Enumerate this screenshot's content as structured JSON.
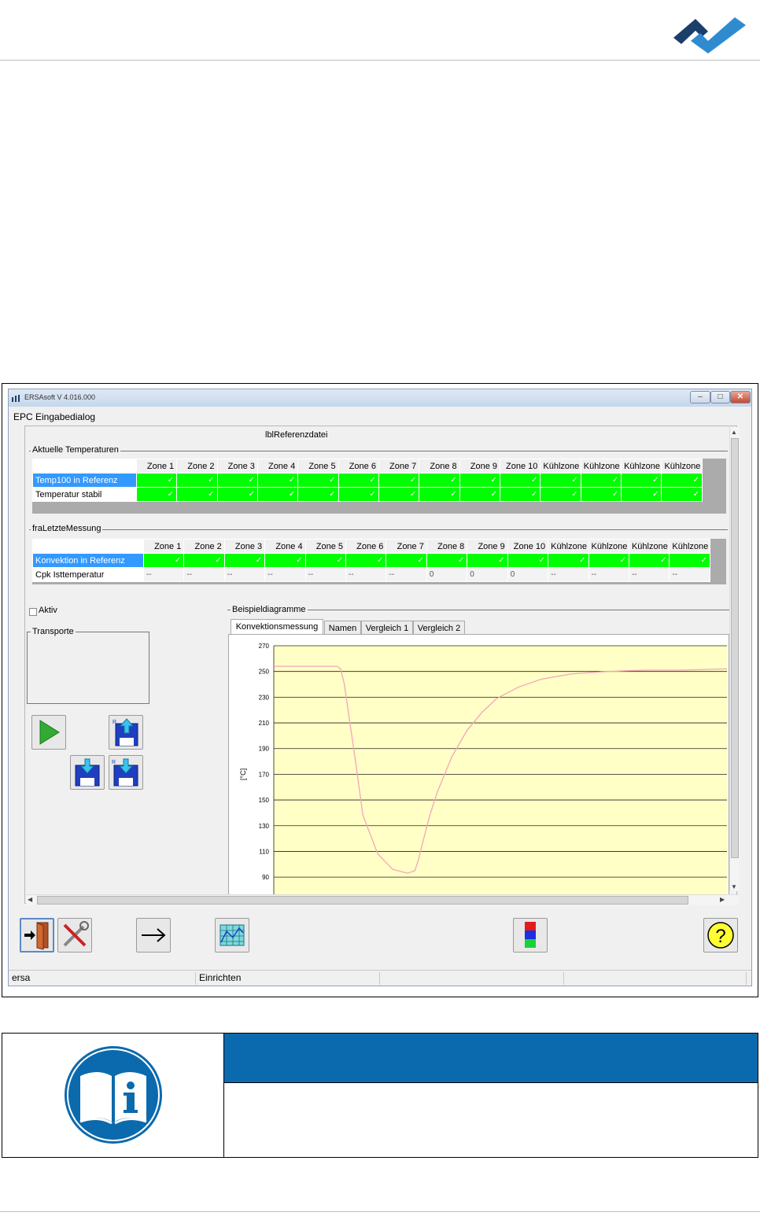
{
  "window": {
    "title": "ERSAsoft V 4.016.000",
    "dialog_caption": "EPC Eingabedialog",
    "reference_label": "lblReferenzdatei",
    "close_glyph": "✕",
    "minimize_glyph": "–",
    "maximize_glyph": "□"
  },
  "current_temps": {
    "group_title": "Aktuelle Temperaturen",
    "columns": [
      "Zone 1",
      "Zone 2",
      "Zone 3",
      "Zone 4",
      "Zone 5",
      "Zone 6",
      "Zone 7",
      "Zone 8",
      "Zone 9",
      "Zone 10",
      "Kühlzone 1",
      "Kühlzone 2",
      "Kühlzone 3",
      "Kühlzone 4"
    ],
    "rows": [
      {
        "label": "Temp100 in Referenz",
        "selected": true,
        "cells": [
          "✓",
          "✓",
          "✓",
          "✓",
          "✓",
          "✓",
          "✓",
          "✓",
          "✓",
          "✓",
          "✓",
          "✓",
          "✓",
          "✓"
        ]
      },
      {
        "label": "Temperatur stabil",
        "selected": false,
        "cells": [
          "✓",
          "✓",
          "✓",
          "✓",
          "✓",
          "✓",
          "✓",
          "✓",
          "✓",
          "✓",
          "✓",
          "✓",
          "✓",
          "✓"
        ]
      }
    ]
  },
  "last_measurement": {
    "group_title": "fraLetzteMessung",
    "columns": [
      "Zone 1",
      "Zone 2",
      "Zone 3",
      "Zone 4",
      "Zone 5",
      "Zone 6",
      "Zone 7",
      "Zone 8",
      "Zone 9",
      "Zone 10",
      "Kühlzone 1",
      "Kühlzone 2",
      "Kühlzone 3",
      "Kühlzone 4"
    ],
    "rows": [
      {
        "label": "Konvektion in Referenz",
        "selected": true,
        "cells": [
          "✓",
          "✓",
          "✓",
          "✓",
          "✓",
          "✓",
          "✓",
          "✓",
          "✓",
          "✓",
          "✓",
          "✓",
          "✓",
          "✓"
        ]
      },
      {
        "label": "Cpk Isttemperatur",
        "selected": false,
        "cells": [
          "--",
          "--",
          "--",
          "--",
          "--",
          "--",
          "--",
          "0",
          "0",
          "0",
          "--",
          "--",
          "--",
          "--"
        ]
      }
    ]
  },
  "controls": {
    "aktiv_label": "Aktiv",
    "aktiv_checked": false,
    "transporte_title": "Transporte"
  },
  "diagrams": {
    "group_title": "Beispieldiagramme",
    "tabs": [
      "Konvektionsmessung",
      "Namen",
      "Vergleich 1",
      "Vergleich 2"
    ],
    "active_tab": 0
  },
  "chart_data": {
    "type": "line",
    "ylabel": "[°C]",
    "y_ticks": [
      270,
      250,
      230,
      210,
      190,
      170,
      150,
      130,
      110,
      90
    ],
    "ylim": [
      76,
      270
    ],
    "grid": true,
    "plot_background": "#ffffc6",
    "series": [
      {
        "color": "#f4a6b8",
        "x": [
          0,
          70,
          80,
          85,
          90,
          95,
          100,
          110,
          120,
          140,
          160,
          180,
          190,
          195,
          200,
          210,
          220,
          240,
          260,
          280,
          300,
          330,
          360,
          400,
          450,
          500,
          550,
          610
        ],
        "values": [
          254,
          254,
          254,
          254,
          252,
          240,
          220,
          180,
          138,
          108,
          96,
          93,
          95,
          104,
          116,
          138,
          156,
          184,
          204,
          218,
          229,
          238,
          244,
          248,
          250,
          251,
          251,
          252
        ]
      }
    ]
  },
  "statusbar": [
    "ersa",
    "Einrichten",
    "",
    "",
    ""
  ],
  "colors": {
    "ok_green": "#00ff00",
    "row_selected": "#3399ff",
    "info_blue": "#0b6aad",
    "logo_dark": "#1b3e6b",
    "logo_light": "#2e8bd0"
  },
  "icons": [
    "exit-door-icon",
    "tools-icon",
    "arrow-right-icon",
    "chart-icon",
    "color-bars-icon",
    "help-icon",
    "play-icon",
    "disk-upload-icon",
    "disk-save-icon",
    "disk-save-r-icon",
    "manual-info-icon",
    "company-logo"
  ]
}
